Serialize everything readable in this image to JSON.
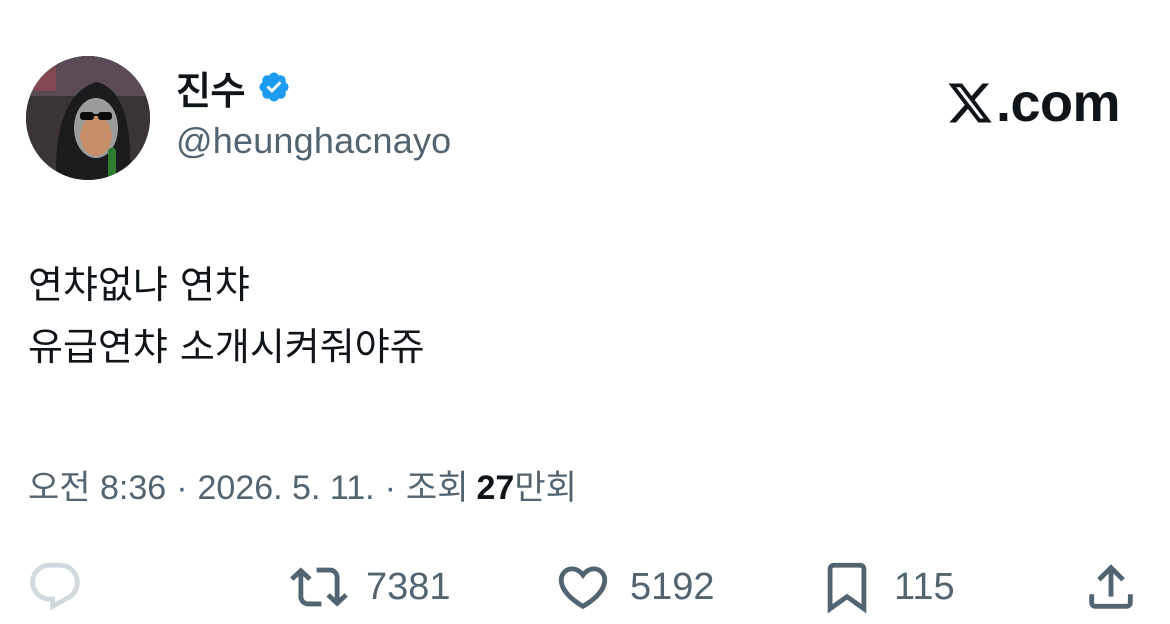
{
  "user": {
    "name": "진수",
    "handle": "@heunghacnayo"
  },
  "brand": {
    "domain": ".com"
  },
  "tweet": {
    "lines": [
      "연챠없냐 연챠",
      "유급연챠 소개시켜줘야쥬"
    ]
  },
  "meta": {
    "time": "오전 8:36",
    "date": "2026. 5. 11.",
    "views_label": "조회",
    "views_number": "27",
    "views_unit": "만회"
  },
  "actions": {
    "reply_icon": "reply-icon",
    "retweet_count": "7381",
    "like_count": "5192",
    "bookmark_count": "115",
    "share_icon": "share-icon"
  },
  "colors": {
    "text": "#0f1419",
    "secondary": "#536471",
    "verified": "#1d9bf0",
    "reply_icon": "#cfd9de"
  }
}
